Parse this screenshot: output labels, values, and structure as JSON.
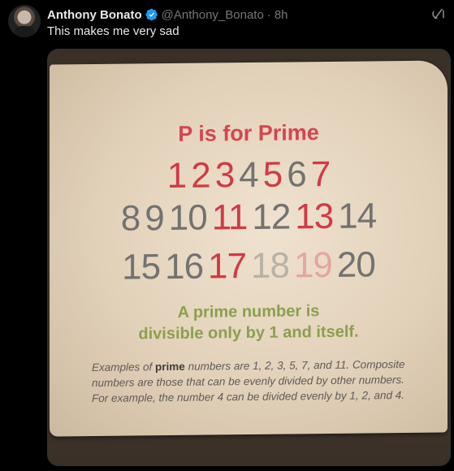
{
  "tweet": {
    "author_name": "Anthony Bonato",
    "handle": "@Anthony_Bonato",
    "separator": "·",
    "time": "8h",
    "text": "This makes me very sad"
  },
  "photo": {
    "title": "P is for Prime",
    "rows": [
      [
        {
          "n": "1",
          "c": "red"
        },
        {
          "n": "2",
          "c": "red"
        },
        {
          "n": "3",
          "c": "red"
        },
        {
          "n": "4",
          "c": "gray"
        },
        {
          "n": "5",
          "c": "red"
        },
        {
          "n": "6",
          "c": "gray"
        },
        {
          "n": "7",
          "c": "red"
        }
      ],
      [
        {
          "n": "8",
          "c": "gray"
        },
        {
          "n": "9",
          "c": "gray"
        },
        {
          "n": "10",
          "c": "gray"
        },
        {
          "n": "11",
          "c": "red"
        },
        {
          "n": "12",
          "c": "gray"
        },
        {
          "n": "13",
          "c": "red"
        },
        {
          "n": "14",
          "c": "gray"
        }
      ],
      [
        {
          "n": "15",
          "c": "gray"
        },
        {
          "n": "16",
          "c": "gray"
        },
        {
          "n": "17",
          "c": "red"
        },
        {
          "n": "18",
          "c": "faded-gray"
        },
        {
          "n": "19",
          "c": "faded"
        },
        {
          "n": "20",
          "c": "gray"
        }
      ]
    ],
    "definition_line1": "A prime number is",
    "definition_line2": "divisible only by 1 and itself.",
    "example_line1_pre": "Examples of ",
    "example_line1_bold": "prime",
    "example_line1_post": " numbers are 1, 2, 3, 5, 7, and 11. Composite",
    "example_line2": "numbers are those that can be evenly divided by other numbers.",
    "example_line3": "For example, the number 4 can be divided evenly by 1, 2, and 4."
  },
  "colors": {
    "background": "#000000",
    "verified_badge": "#1d9bf0",
    "title_red": "#d64550",
    "definition_green": "#8ba04e"
  },
  "icons": {
    "verified": "verified-badge-icon",
    "grok": "grok-icon"
  }
}
